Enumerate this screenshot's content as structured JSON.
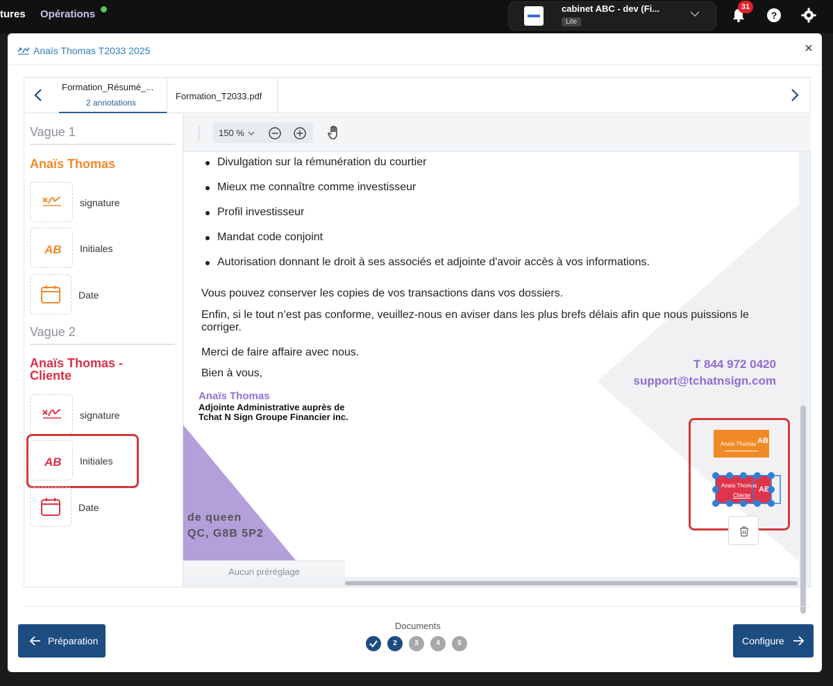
{
  "topbar": {
    "nav_item_1": "tures",
    "nav_item_2": "Opérations",
    "account_name": "cabinet ABC - dev (Fi...",
    "account_plan": "Lite",
    "notifications_count": "31"
  },
  "modal": {
    "title": "Anaïs Thomas T2033 2025"
  },
  "tabs": [
    {
      "title": "Formation_Résumé_...",
      "subtitle": "2 annotations"
    },
    {
      "title": "Formation_T2033.pdf"
    }
  ],
  "sidebar": {
    "wave1": {
      "label": "Vague 1",
      "signer": "Anaïs Thomas",
      "color": "#ef8a2a",
      "fields": [
        "signature",
        "Initiales",
        "Date"
      ]
    },
    "wave2": {
      "label": "Vague 2",
      "signer": "Anaïs Thomas - Cliente",
      "color": "#d92f45",
      "fields": [
        "signature",
        "Initiales",
        "Date"
      ]
    }
  },
  "viewer": {
    "zoom": "150 %",
    "document": {
      "bullets": [
        "Divulgation sur la rémunération du courtier",
        "Mieux me connaître comme investisseur",
        "Profil investisseur",
        "Mandat code conjoint",
        "Autorisation donnant le droit à ses associés et adjointe d'avoir accès à vos informations."
      ],
      "p1": "Vous pouvez conserver les copies de vos transactions dans vos dossiers.",
      "p2": "Enfin, si le tout n’est pas conforme, veuillez-nous en aviser dans les plus brefs délais afin que nous puissions le corriger.",
      "p3": "Merci de faire affaire avec nous.",
      "p4": "Bien à vous,",
      "signer_name": "Anaïs Thomas",
      "signer_role_line1": "Adjointe Administrative auprès de",
      "signer_role_line2": "Tchat N Sign Groupe Financier inc.",
      "phone": "T 844 972 0420",
      "email": "support@tchatnsign.com",
      "address_line1": "de queen",
      "address_line2": "QC, G8B 5P2"
    },
    "annotation1": {
      "name": "Anaïs Thomas",
      "mark": "AB"
    },
    "annotation2": {
      "name": "Anaïs Thomas",
      "sub": "Cliente",
      "mark": "AB"
    },
    "preset_label": "Aucun préréglage"
  },
  "footer": {
    "prev_label": "Préparation",
    "next_label": "Configure",
    "docs_label": "Documents",
    "steps": [
      "",
      "2",
      "3",
      "4",
      "5"
    ],
    "current_step": 2
  }
}
